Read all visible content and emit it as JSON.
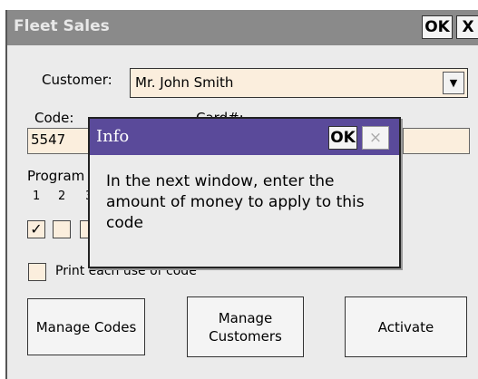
{
  "window": {
    "title": "Fleet Sales",
    "ok_label": "OK",
    "close_label": "X"
  },
  "customer": {
    "label": "Customer:",
    "value": "Mr. John Smith"
  },
  "code": {
    "label": "Code:",
    "value": "5547"
  },
  "card": {
    "label": "Card#:"
  },
  "program": {
    "label": "Program",
    "numbers": [
      "1",
      "2",
      "3"
    ]
  },
  "checkboxes": [
    {
      "checked": true,
      "mark": "✓"
    },
    {
      "checked": false
    },
    {
      "checked": false
    }
  ],
  "print_each": {
    "label": "Print each use of code"
  },
  "buttons": {
    "manage_codes": "Manage Codes",
    "manage_customers_1": "Manage",
    "manage_customers_2": "Customers",
    "activate": "Activate"
  },
  "dialog": {
    "title": "Info",
    "ok_label": "OK",
    "close_label": "×",
    "message": "In the next window, enter the amount of money to apply to this code"
  },
  "colors": {
    "title_bar": "#8a8a8a",
    "dialog_title_bar": "#5a4a9a",
    "field_bg": "#fbeedd"
  }
}
